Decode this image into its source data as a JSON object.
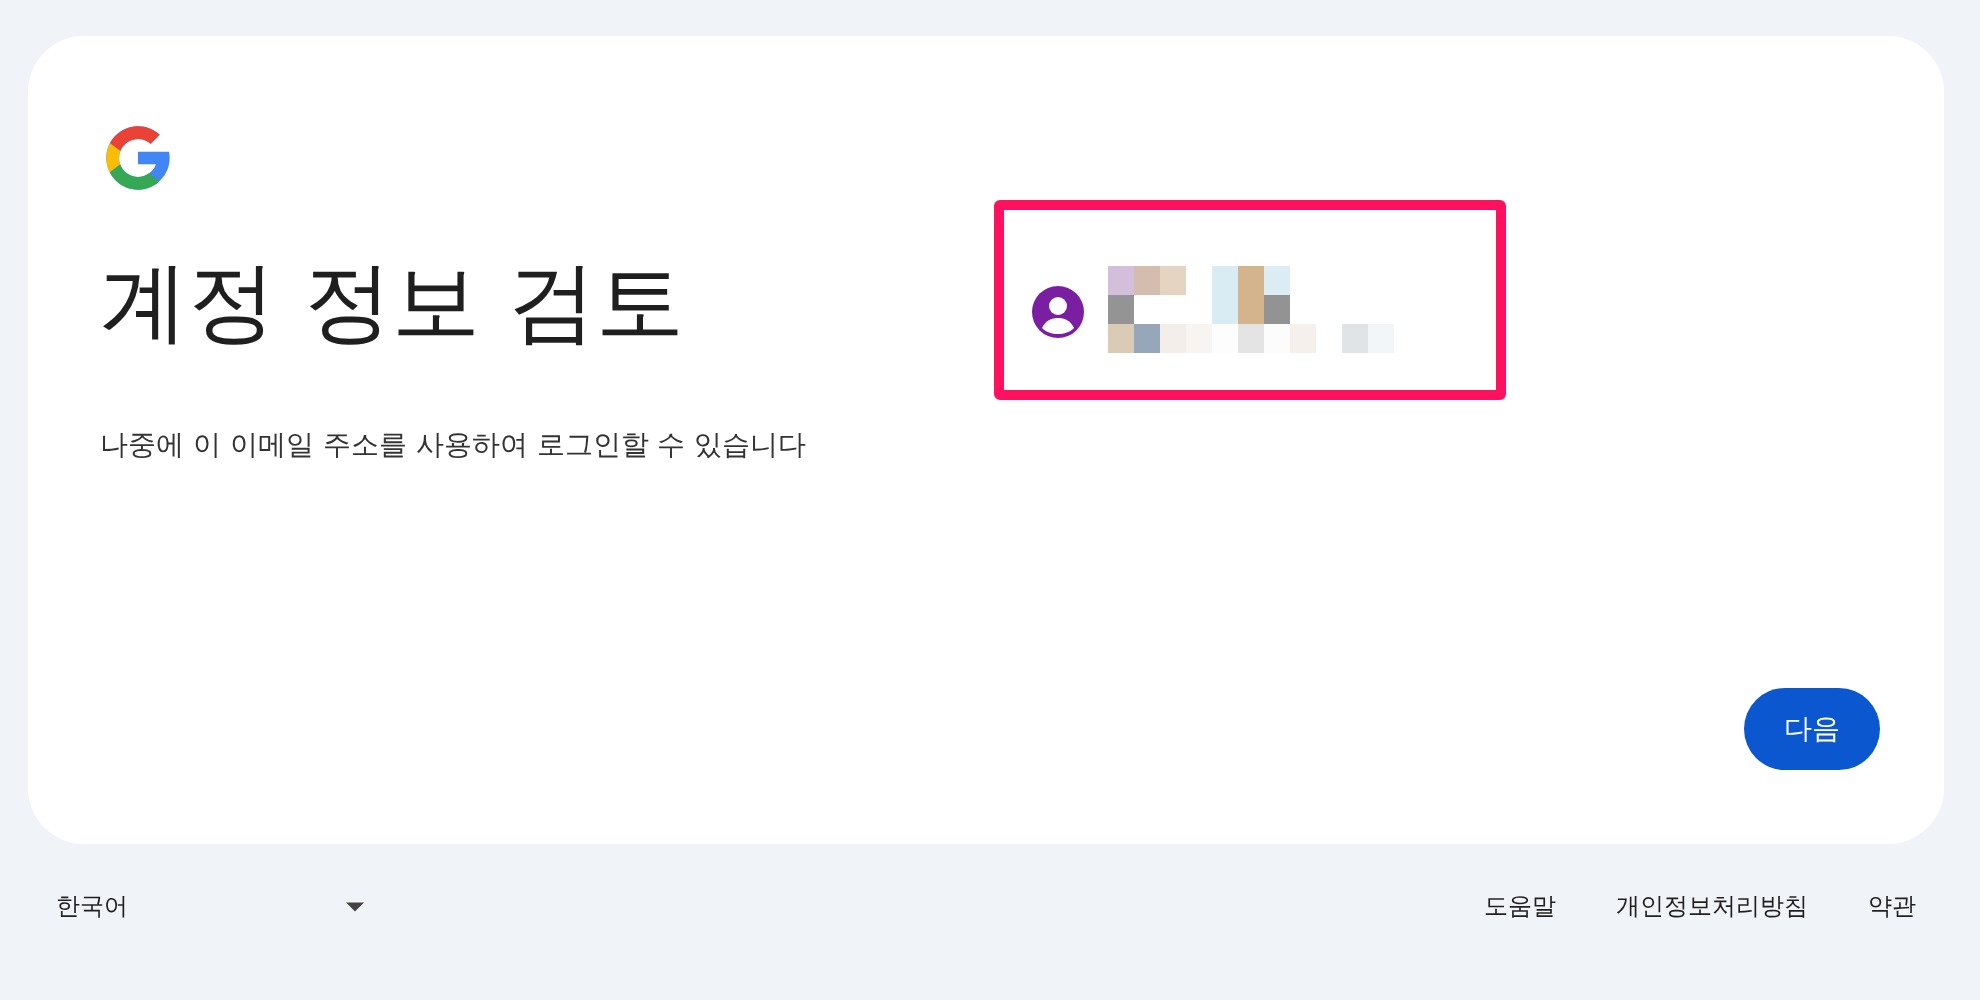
{
  "card": {
    "title": "계정 정보 검토",
    "subtitle": "나중에 이 이메일 주소를 사용하여 로그인할 수 있습니다",
    "account": {
      "highlighted": true
    },
    "next_button": "다음"
  },
  "footer": {
    "language": "한국어",
    "links": [
      "도움말",
      "개인정보처리방침",
      "약관"
    ]
  }
}
